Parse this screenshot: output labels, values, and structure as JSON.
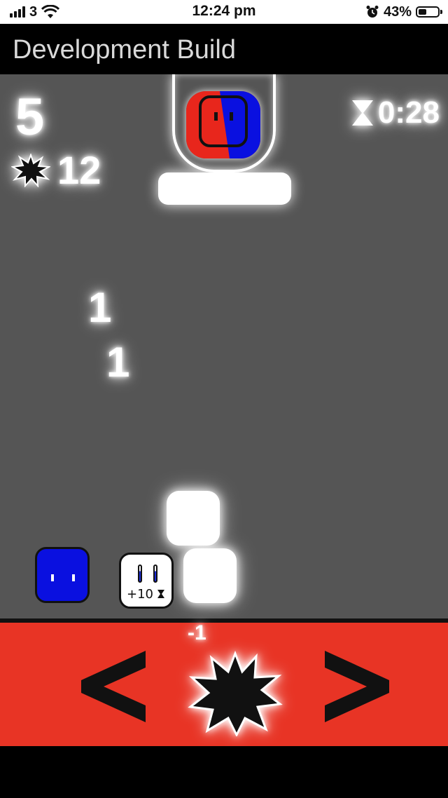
{
  "status_bar": {
    "carrier": "3",
    "time": "12:24 pm",
    "battery": "43%",
    "battery_level": 0.43
  },
  "app": {
    "title": "Development Build"
  },
  "hud": {
    "score": "5",
    "burst_count": "12",
    "timer": "0:28"
  },
  "floating_numbers": [
    "1",
    "1"
  ],
  "player_block": {
    "color": "#0a10e0"
  },
  "powerup": {
    "label": "+10",
    "icon": "hourglass-icon"
  },
  "capsule": {
    "colors": [
      "#e8261c",
      "#0a10e0"
    ]
  },
  "controls": {
    "left_symbol": "<",
    "right_symbol": ">",
    "burst_cost": "-1",
    "background": "#e83425"
  }
}
